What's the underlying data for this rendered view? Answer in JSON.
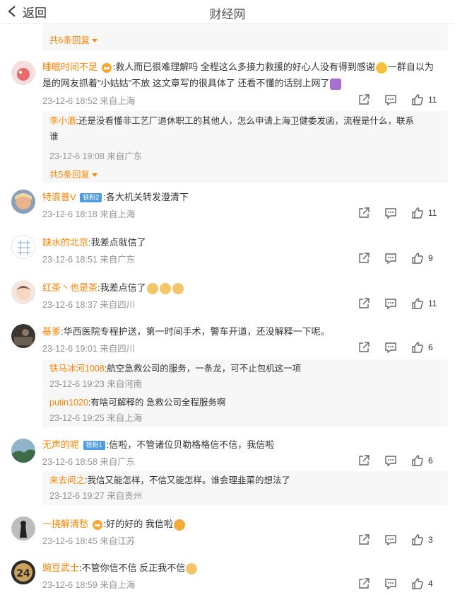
{
  "header": {
    "back_label": "返回",
    "title": "财经网"
  },
  "top_reply_toggle": "共6条回复",
  "comments": [
    {
      "name": "睡眠时间不足",
      "text_a": ":救人而已很难理解吗 全程这么多接力救援的好心人没有得到感谢",
      "text_b": "一群自以为",
      "text_c": "是的网友抓着\"小姑姑\"不放 这文章写的很具体了 还看不懂的话别上网了",
      "meta": "23-12-6 18:52 来自上海",
      "likes": "11",
      "replies": [
        {
          "name": "李小酒",
          "text": ":还是没看懂非工艺厂退休职工的其他人，怎么申请上海卫健委发函，流程是什么，联系",
          "text2": "谁",
          "meta": "23-12-6 19:08 来自广东"
        }
      ],
      "reply_toggle": "共5条回复"
    },
    {
      "name": "特浪普V",
      "badge": "铁粉2",
      "text": ":各大机关转发澄清下",
      "meta": "23-12-6 18:18 来自上海",
      "likes": "11"
    },
    {
      "name": "缺水的北京",
      "text": ":我差点就信了",
      "meta": "23-12-6 18:51 来自广东",
      "likes": "9"
    },
    {
      "name": "红茶丶也是茶",
      "text": ":我差点信了",
      "meta": "23-12-6 18:37 来自四川",
      "likes": "11"
    },
    {
      "name": "基爹",
      "text": ":华西医院专程护送，第一时间手术，警车开道，还没解释一下呢。",
      "meta": "23-12-6 19:01 来自四川",
      "likes": "6",
      "replies": [
        {
          "name": "铁马冰河1008",
          "text": ":航空急救公司的服务，一条龙，可不止包机这一项",
          "meta": "23-12-6 19:23 来自河南"
        },
        {
          "name": "putin1020",
          "text": ":有啥可解释的 急救公司全程服务啊",
          "meta": "23-12-6 19:25 来自上海"
        }
      ]
    },
    {
      "name": "无声的呢",
      "badge": "铁粉1",
      "text": ":信啦，不管诸位贝勒格格信不信，我信啦",
      "meta": "23-12-6 18:58 来自广东",
      "likes": "6",
      "replies": [
        {
          "name": "来去问之",
          "text": ":我信又能怎样，不信又能怎样。谁会理韭菜的想法了",
          "meta": "23-12-6 19:27 来自贵州"
        }
      ]
    },
    {
      "name": "一挠解清愁",
      "text": ":好的好的 我信啦",
      "meta": "23-12-6 18:45 来自江苏",
      "likes": "3"
    },
    {
      "name": "豌豆武士",
      "text": ":不管你信不信 反正我不信",
      "meta": "23-12-6 18:59 来自上海",
      "likes": "4",
      "avatar_label": "24"
    }
  ],
  "colors": {
    "accent": "#ff8200",
    "meta": "#939393",
    "badge": "#4e9de3"
  }
}
